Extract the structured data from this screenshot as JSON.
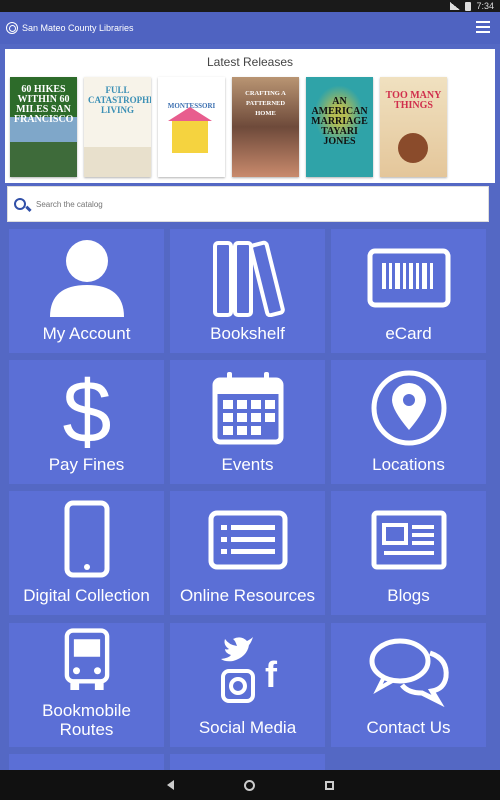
{
  "status_bar": {
    "time": "7:34"
  },
  "app_bar": {
    "logo_text": "San Mateo County Libraries"
  },
  "releases": {
    "title": "Latest Releases",
    "books": [
      {
        "title": "60 HIKES WITHIN 60 MILES SAN FRANCISCO"
      },
      {
        "title": "FULL CATASTROPHE LIVING"
      },
      {
        "title": "MONTESSORI"
      },
      {
        "title": "CRAFTING A PATTERNED HOME"
      },
      {
        "title": "AN AMERICAN MARRIAGE TAYARI JONES"
      },
      {
        "title": "TOO MANY THINGS"
      }
    ]
  },
  "search": {
    "placeholder": "Search the catalog"
  },
  "tiles": [
    {
      "label": "My Account"
    },
    {
      "label": "Bookshelf"
    },
    {
      "label": "eCard"
    },
    {
      "label": "Pay Fines"
    },
    {
      "label": "Events"
    },
    {
      "label": "Locations"
    },
    {
      "label": "Digital Collection"
    },
    {
      "label": "Online Resources"
    },
    {
      "label": "Blogs"
    },
    {
      "label": "Bookmobile Routes"
    },
    {
      "label": "Social Media"
    },
    {
      "label": "Contact Us"
    }
  ],
  "colors": {
    "background": "#5468c4",
    "tile": "#5b6fd6",
    "app_bar": "#4f63c1"
  },
  "icons": [
    "person-icon",
    "books-icon",
    "barcode-card-icon",
    "dollar-icon",
    "calendar-icon",
    "location-pin-icon",
    "tablet-icon",
    "list-icon",
    "newspaper-icon",
    "bus-icon",
    "social-icon",
    "chat-bubbles-icon"
  ]
}
